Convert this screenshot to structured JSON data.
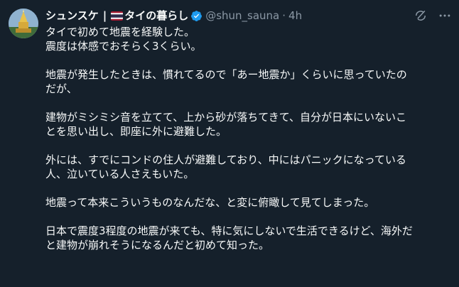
{
  "tweet": {
    "author": {
      "display_name": "シュンスケ",
      "separator": "|",
      "display_name_suffix": "タイの暮らし",
      "handle": "@shun_sauna",
      "verified": true
    },
    "dot": "·",
    "time": "4h",
    "icons": {
      "avatar": "avatar-temple-image",
      "flag": "thailand-flag-icon",
      "verified": "verified-badge-icon",
      "grok": "grok-icon",
      "more": "more-options-icon"
    },
    "paragraphs": [
      "タイで初めて地震を経験した。\n震度は体感でおそらく3くらい。",
      "地震が発生したときは、慣れてるので「あー地震か」くらいに思っていたの\nだが、",
      "建物がミシミシ音を立てて、上から砂が落ちてきて、自分が日本にいないこ\nとを思い出し、即座に外に避難した。",
      "外には、すでにコンドの住人が避難しており、中にはパニックになっている\n人、泣いている人さえもいた。",
      "地震って本来こういうものなんだな、と変に俯瞰して見てしまった。",
      "日本で震度3程度の地震が来ても、特に気にしないで生活できるけど、海外だ\nと建物が崩れそうになるんだと初めて知った。"
    ]
  },
  "colors": {
    "background": "#15202b",
    "text": "#f7f9f9",
    "secondary_text": "#8b98a5",
    "verified_blue": "#1d9bf0"
  }
}
